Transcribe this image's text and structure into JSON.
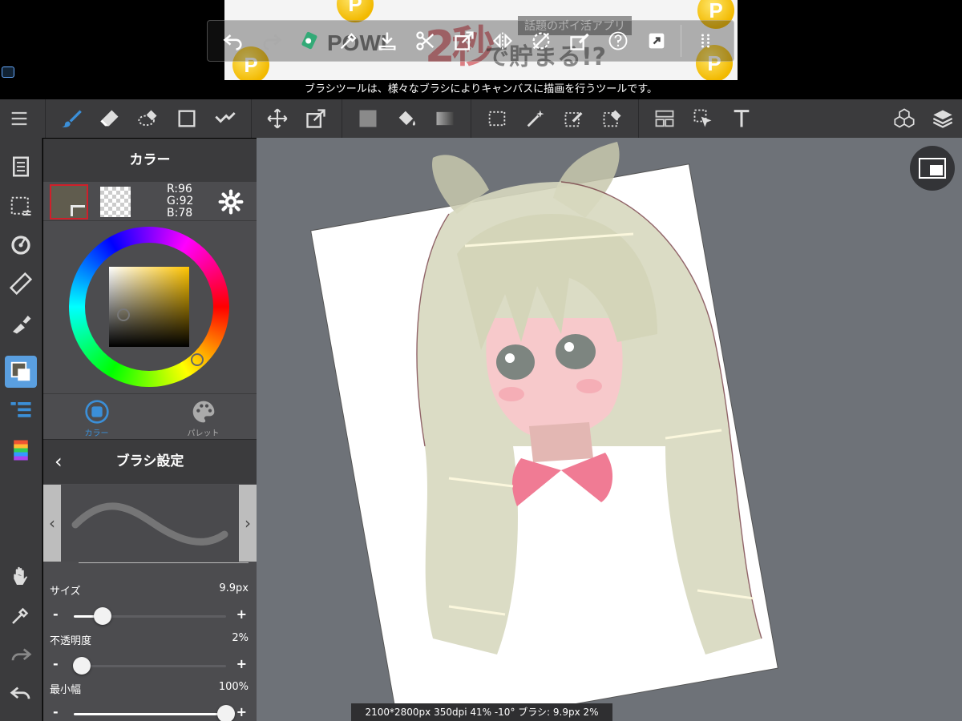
{
  "colors": {
    "accent": "#3b8fd8",
    "toolbar_bg": "#3b3b3d",
    "panel_bg": "#4c4c4f",
    "canvas_bg": "#6e7278",
    "current_color": "#605c4e"
  },
  "ad": {
    "brand": "POWL",
    "headline": "2秒",
    "subline": "で貯まる!?",
    "tag": "話題のポイ活アプリ",
    "coin_label": "P"
  },
  "hint": "ブラシツールは、様々なブラシによりキャンバスに描画を行うツールです。",
  "float_toolbar": {
    "icons": [
      "undo-icon",
      "redo-icon",
      "select-all-icon",
      "eyedropper-icon",
      "import-icon",
      "cut-icon",
      "transform-icon",
      "flip-icon",
      "clear-selection-icon",
      "edit-selection-icon",
      "help-icon",
      "share-icon",
      "grip-icon"
    ]
  },
  "toolbar": {
    "tools": [
      "menu-icon",
      "brush-icon",
      "eraser-icon",
      "lasso-eraser-icon",
      "rectangle-icon",
      "select-icon",
      "move-icon",
      "transform-icon",
      "fill-color-icon",
      "paint-bucket-icon",
      "gradient-icon",
      "rect-select-icon",
      "magic-wand-icon",
      "select-pen-icon",
      "select-eraser-icon",
      "tile-icon",
      "pointer-select-icon",
      "text-icon",
      "3d-icon",
      "layers-icon"
    ]
  },
  "left_tools": [
    "pages-icon",
    "selection-icon",
    "snap-icon",
    "ruler-icon",
    "fill-pen-icon",
    "color-icon",
    "layer-list-icon",
    "color-bar-icon",
    "hand-icon",
    "eyedropper-icon",
    "redo-icon",
    "undo-icon"
  ],
  "color_panel": {
    "title": "カラー",
    "r": "R:96",
    "g": "G:92",
    "b": "B:78",
    "tab_color": "カラー",
    "tab_palette": "パレット"
  },
  "brush_panel": {
    "title": "ブラシ設定",
    "back": "‹",
    "prev": "‹",
    "next": "›",
    "size_label": "サイズ",
    "size_value": "9.9px",
    "size_level": 0.19,
    "opacity_label": "不透明度",
    "opacity_value": "2%",
    "opacity_level": 0.05,
    "min_width_label": "最小幅",
    "min_width_value": "100%",
    "min_width_level": 1.0,
    "minus": "-",
    "plus": "+"
  },
  "status": "2100*2800px 350dpi 41% -10° ブラシ: 9.9px 2%"
}
